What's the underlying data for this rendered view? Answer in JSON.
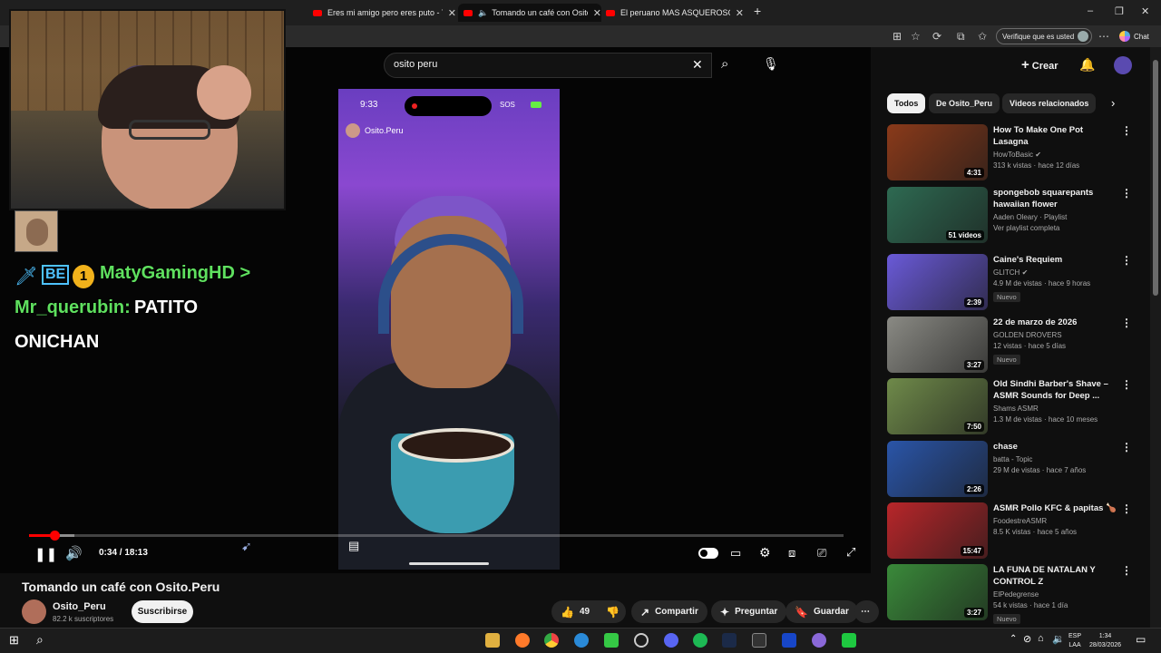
{
  "browser": {
    "tabs": [
      {
        "title": "Eres mi amigo pero eres puto - Yo",
        "active": false
      },
      {
        "title": "Tomando un café con Osito.Pe",
        "active": true
      },
      {
        "title": "El peruano MAS ASQUEROSO (osi",
        "active": false
      }
    ],
    "verify_label": "Verifique que es usted",
    "copilot_label": "Chat"
  },
  "masthead": {
    "search_value": "osito peru",
    "create_label": "Crear"
  },
  "video": {
    "phone_time": "9:33",
    "phone_signal": "SOS",
    "phone_channel": "Osito.Peru",
    "overlay": {
      "user1": "MatyGamingHD >",
      "badge_num": "1",
      "badge_text": "BE",
      "user2": "Mr_querubin:",
      "msg_line1": "PATITO",
      "msg_line2": "ONICHAN"
    },
    "time_display": "0:34 / 18:13",
    "played_fraction": 0.031,
    "buffered_fraction": 0.056
  },
  "watch": {
    "title": "Tomando un café con Osito.Peru",
    "channel": "Osito_Peru",
    "subscribers": "82.2 k suscriptores",
    "subscribe_label": "Suscribirse",
    "likes": "49",
    "share_label": "Compartir",
    "ask_label": "Preguntar",
    "save_label": "Guardar"
  },
  "chips": [
    "Todos",
    "De Osito_Peru",
    "Videos relacionados"
  ],
  "related": [
    {
      "title": "How To Make One Pot Lasagna",
      "channel": "HowToBasic",
      "verified": true,
      "meta": "313 k vistas · hace 12 días",
      "duration": "4:31",
      "badge": "",
      "thumb": "#8a3a1a"
    },
    {
      "title": "spongebob squarepants hawaiian flower",
      "channel": "Aaden Oleary · Playlist",
      "verified": false,
      "meta": "Ver playlist completa",
      "duration": "51 videos",
      "badge": "",
      "thumb": "#2e6a52"
    },
    {
      "title": "Caine's Requiem",
      "channel": "GLITCH",
      "verified": true,
      "meta": "4.9 M de vistas · hace 9 horas",
      "duration": "2:39",
      "badge": "Nuevo",
      "thumb": "#6a5ad8"
    },
    {
      "title": "22 de marzo de 2026",
      "channel": "GOLDEN DROVERS",
      "verified": false,
      "meta": "12 vistas · hace 5 días",
      "duration": "3:27",
      "badge": "Nuevo",
      "thumb": "#8a8a84"
    },
    {
      "title": "Old Sindhi Barber's Shave – ASMR Sounds for Deep ...",
      "channel": "Shams ASMR",
      "verified": false,
      "meta": "1.3 M de vistas · hace 10 meses",
      "duration": "7:50",
      "badge": "",
      "thumb": "#6f8a4a"
    },
    {
      "title": "chase",
      "channel": "batta - Topic",
      "verified": false,
      "meta": "29 M de vistas · hace 7 años",
      "duration": "2:26",
      "badge": "",
      "thumb": "#2a55a8"
    },
    {
      "title": "ASMR Pollo KFC & papitas 🍗",
      "channel": "FoodestreASMR",
      "verified": false,
      "meta": "8.5 K vistas · hace 5 años",
      "duration": "15:47",
      "badge": "",
      "thumb": "#b8262a"
    },
    {
      "title": "LA FUNA DE NATALAN Y CONTROL Z",
      "channel": "ElPedegrense",
      "verified": false,
      "meta": "54 k vistas · hace 1 día",
      "duration": "3:27",
      "badge": "Nuevo",
      "thumb": "#3a8a3a"
    }
  ],
  "taskbar": {
    "lang_1": "ESP",
    "lang_2": "LAA",
    "time": "1:34",
    "date": "28/03/2026"
  }
}
